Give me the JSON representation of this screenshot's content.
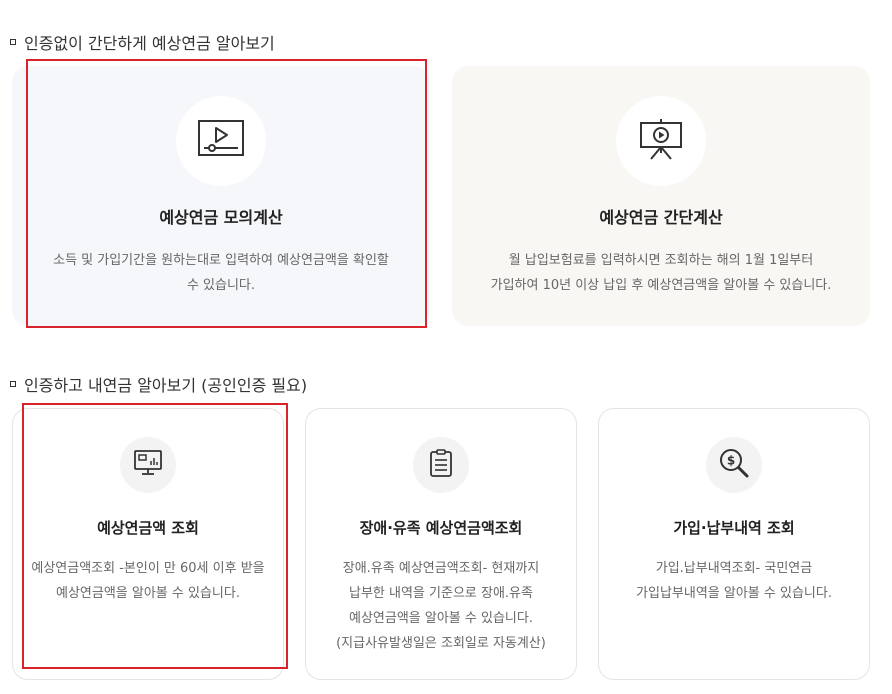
{
  "section1": {
    "title": "인증없이 간단하게 예상연금 알아보기",
    "cards": [
      {
        "title": "예상연금 모의계산",
        "desc_line1": "소득 및 가입기간을 원하는대로 입력하여 예상연금액을 확인할",
        "desc_line2": "수 있습니다.",
        "icon": "video-player-icon"
      },
      {
        "title": "예상연금 간단계산",
        "desc_line1": "월 납입보험료를 입력하시면 조회하는 해의 1월 1일부터",
        "desc_line2": "가입하여 10년 이상 납입 후 예상연금액을 알아볼 수 있습니다.",
        "icon": "presentation-board-icon"
      }
    ]
  },
  "section2": {
    "title": "인증하고 내연금 알아보기 (공인인증 필요)",
    "cards": [
      {
        "title": "예상연금액 조회",
        "desc_line1": "예상연금액조회 -본인이 만 60세 이후 받을",
        "desc_line2": "예상연금액을 알아볼 수 있습니다.",
        "icon": "monitor-chart-icon"
      },
      {
        "title": "장애·유족 예상연금액조회",
        "desc_line1": "장애.유족 예상연금액조회- 현재까지",
        "desc_line2": "납부한 내역을 기준으로 장애.유족",
        "desc_line3": "예상연금액을 알아볼 수 있습니다.",
        "desc_line4": "(지급사유발생일은 조회일로 자동계산)",
        "icon": "clipboard-icon"
      },
      {
        "title": "가입·납부내역 조회",
        "desc_line1": "가입.납부내역조회- 국민연금",
        "desc_line2": "가입납부내역을 알아볼 수 있습니다.",
        "icon": "dollar-search-icon"
      }
    ]
  },
  "colors": {
    "highlight": "#d9242c",
    "card_gray": "#f6f7fa",
    "card_beige": "#f9f7f4"
  }
}
